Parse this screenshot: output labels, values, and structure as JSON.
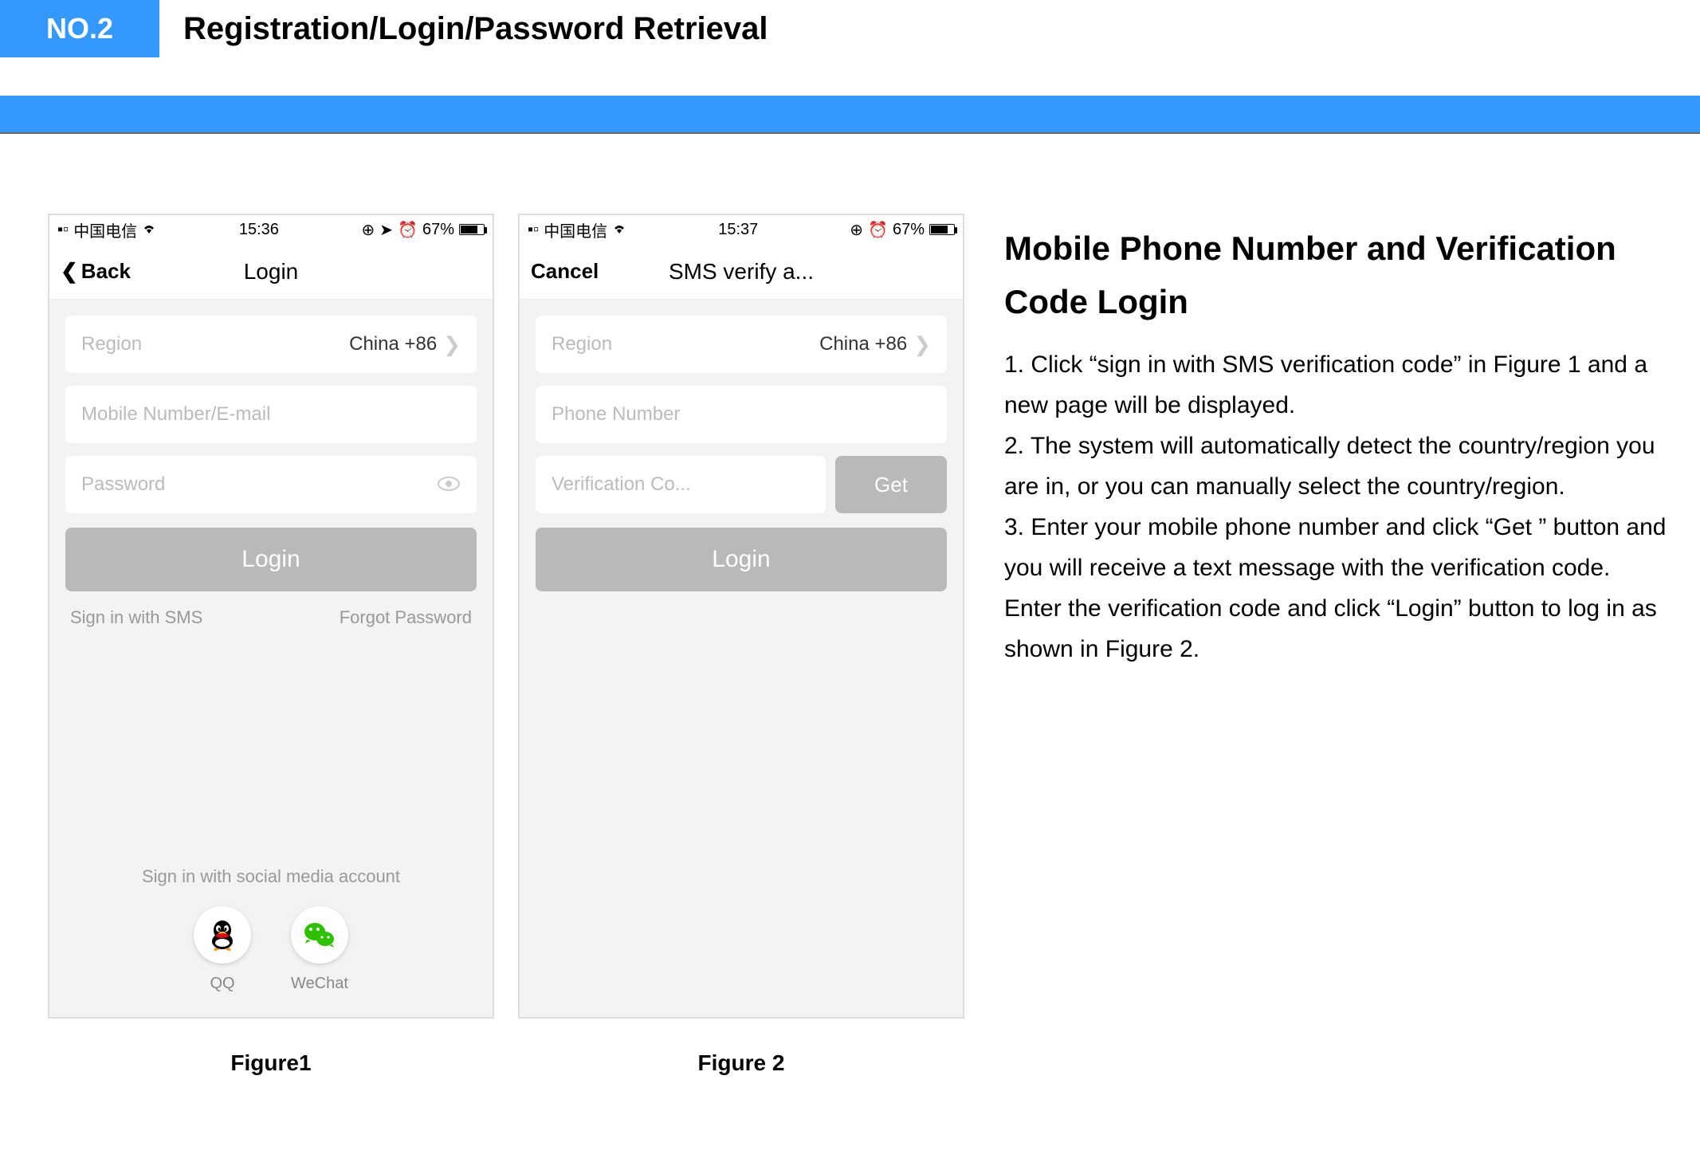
{
  "header": {
    "badge": "NO.2",
    "title": "Registration/Login/Password Retrieval"
  },
  "figure1": {
    "status": {
      "carrier": "中国电信",
      "time": "15:36",
      "battery_pct": "67%"
    },
    "nav": {
      "back": "Back",
      "title": "Login"
    },
    "region_label": "Region",
    "region_value": "China +86",
    "mobile_placeholder": "Mobile Number/E-mail",
    "password_placeholder": "Password",
    "login_btn": "Login",
    "sms_link": "Sign in with SMS",
    "forgot_link": "Forgot Password",
    "social_title": "Sign in with social media account",
    "social": {
      "qq": "QQ",
      "wechat": "WeChat"
    },
    "caption": "Figure1"
  },
  "figure2": {
    "status": {
      "carrier": "中国电信",
      "time": "15:37",
      "battery_pct": "67%"
    },
    "nav": {
      "cancel": "Cancel",
      "title": "SMS verify a..."
    },
    "region_label": "Region",
    "region_value": "China +86",
    "phone_placeholder": "Phone Number",
    "code_placeholder": "Verification Co...",
    "get_btn": "Get",
    "login_btn": "Login",
    "caption": "Figure 2"
  },
  "instructions": {
    "title": "Mobile Phone Number and Verification Code Login",
    "step1": "1. Click “sign in with SMS verification code” in Figure 1 and a new page will be displayed.",
    "step2": "2. The system will automatically detect the country/region you are in, or you can manually select the country/region.",
    "step3": "3. Enter your mobile phone number and click “Get ” button and you will receive a text message with the verification code. Enter the verification code and click “Login” button to log in as shown in Figure 2."
  }
}
